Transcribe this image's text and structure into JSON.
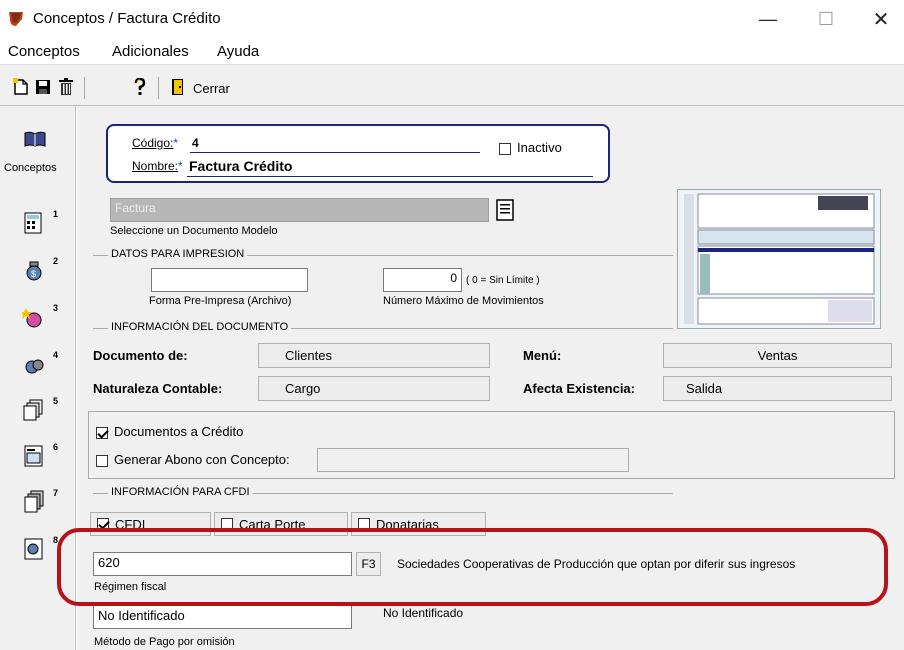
{
  "window": {
    "title": "Conceptos / Factura Crédito",
    "min": "—",
    "max": "☐",
    "close": "✕"
  },
  "menu": [
    "Conceptos",
    "Adicionales",
    "Ayuda"
  ],
  "toolbar": {
    "close_label": "Cerrar"
  },
  "sidebar": {
    "label": "Conceptos",
    "numbers": [
      "1",
      "2",
      "3",
      "4",
      "5",
      "6",
      "7",
      "8"
    ]
  },
  "header": {
    "codigo_label": "Código:",
    "codigo_req": "*",
    "codigo_value": "4",
    "nombre_label": "Nombre:",
    "nombre_req": "*",
    "nombre_value": "Factura Crédito",
    "inactivo_label": "Inactivo",
    "inactivo_checked": false
  },
  "modelo": {
    "value": "Factura",
    "label": "Seleccione un Documento Modelo"
  },
  "impresion": {
    "section": "DATOS PARA IMPRESION",
    "forma_value": "",
    "forma_label": "Forma Pre-Impresa (Archivo)",
    "max_mov_value": "0",
    "max_mov_hint": "( 0 = Sin Límite )",
    "max_mov_label": "Número Máximo de Movimientos"
  },
  "documento": {
    "section": "INFORMACIÓN  DEL DOCUMENTO",
    "doc_de_label": "Documento de:",
    "doc_de_value": "Clientes",
    "menu_label": "Menú:",
    "menu_value": "Ventas",
    "naturaleza_label": "Naturaleza Contable:",
    "naturaleza_value": "Cargo",
    "afecta_label": "Afecta Existencia:",
    "afecta_value": "Salida"
  },
  "credito": {
    "docs_credito_label": "Documentos a Crédito",
    "docs_credito_checked": true,
    "generar_abono_label": "Generar Abono con Concepto:",
    "generar_abono_checked": false
  },
  "cfdi": {
    "section": "INFORMACIÓN PARA CFDI",
    "tabs": [
      {
        "label": "CFDI",
        "checked": true
      },
      {
        "label": "Carta Porte",
        "checked": false
      },
      {
        "label": "Donatarias",
        "checked": false
      }
    ],
    "regimen_value": "620",
    "regimen_key": "F3",
    "regimen_desc": "Sociedades Cooperativas de Producción que optan por diferir sus ingresos",
    "regimen_label": "Régimen fiscal",
    "metodo_value": "No Identificado",
    "metodo_desc": "No Identificado",
    "metodo_label": "Método de Pago por omisión"
  },
  "colors": {
    "highlight": "#b5121b",
    "frame": "#1a237e"
  }
}
